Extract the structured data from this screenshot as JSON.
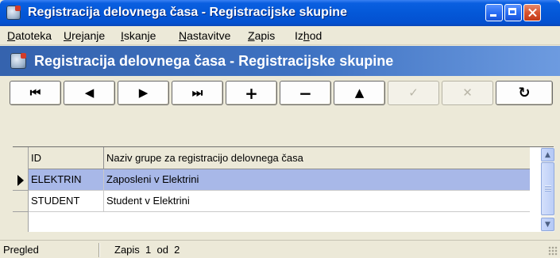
{
  "window": {
    "title": "Registracija delovnega časa - Registracijske skupine"
  },
  "menu": {
    "items": [
      {
        "prefix": "",
        "accel": "D",
        "rest": "atoteka"
      },
      {
        "prefix": "",
        "accel": "U",
        "rest": "rejanje"
      },
      {
        "prefix": "",
        "accel": "I",
        "rest": "skanje"
      },
      {
        "prefix": "",
        "accel": "N",
        "rest": "astavitve"
      },
      {
        "prefix": "",
        "accel": "Z",
        "rest": "apis"
      },
      {
        "prefix": "Iz",
        "accel": "h",
        "rest": "od"
      }
    ]
  },
  "banner": {
    "title": "Registracija delovnega časa - Registracijske skupine"
  },
  "toolbar": {
    "buttons": [
      {
        "name": "first-record-button",
        "glyph": "⏮",
        "enabled": true
      },
      {
        "name": "prior-record-button",
        "glyph": "◀",
        "enabled": true
      },
      {
        "name": "next-record-button",
        "glyph": "▶",
        "enabled": true
      },
      {
        "name": "last-record-button",
        "glyph": "⏭",
        "enabled": true
      },
      {
        "name": "insert-record-button",
        "glyph": "+",
        "enabled": true
      },
      {
        "name": "delete-record-button",
        "glyph": "−",
        "enabled": true
      },
      {
        "name": "edit-record-button",
        "glyph": "▲",
        "enabled": true
      },
      {
        "name": "post-record-button",
        "glyph": "✓",
        "enabled": false
      },
      {
        "name": "cancel-edit-button",
        "glyph": "✕",
        "enabled": false
      },
      {
        "name": "refresh-button",
        "glyph": "↻",
        "enabled": true
      }
    ]
  },
  "grid": {
    "columns": [
      "ID",
      "Naziv grupe za registracijo delovnega časa"
    ],
    "rows": [
      {
        "id": "ELEKTRIN",
        "name": "Zaposleni v Elektrini",
        "selected": true
      },
      {
        "id": "STUDENT",
        "name": "Student v Elektrini",
        "selected": false
      }
    ]
  },
  "statusbar": {
    "mode": "Pregled",
    "record": "Zapis  1  od  2"
  }
}
